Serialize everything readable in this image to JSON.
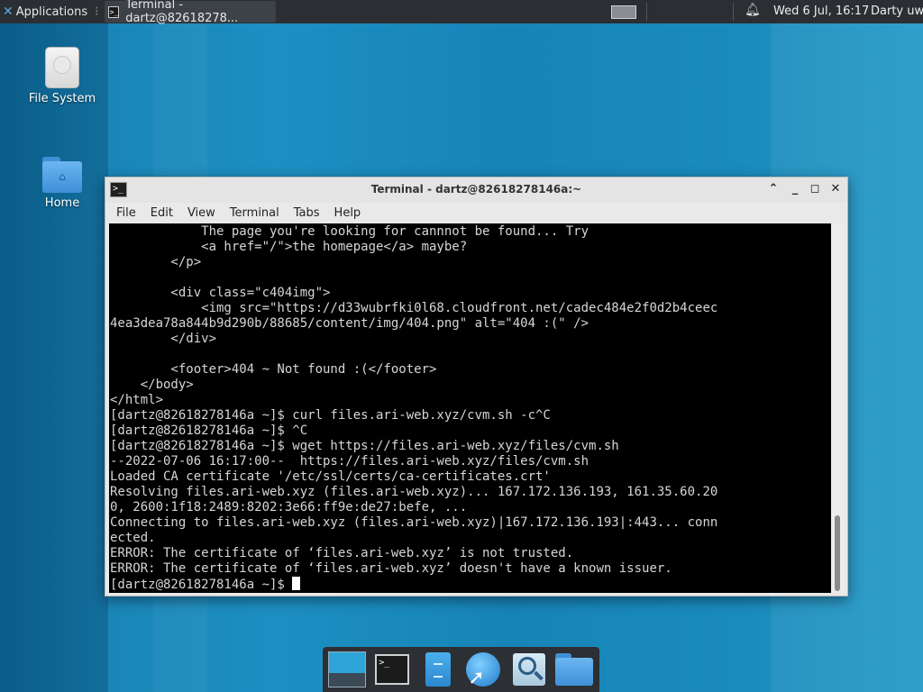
{
  "top_panel": {
    "applications_label": "Applications",
    "task_title": "Terminal - dartz@82618278...",
    "clock": "Wed  6 Jul, 16:17",
    "user": "Darty uwu"
  },
  "desktop": {
    "icons": [
      {
        "label": "File System",
        "icon": "drive-icon"
      },
      {
        "label": "Home",
        "icon": "home-folder-icon"
      }
    ]
  },
  "window": {
    "title": "Terminal - dartz@82618278146a:~",
    "menu": [
      "File",
      "Edit",
      "View",
      "Terminal",
      "Tabs",
      "Help"
    ],
    "terminal_lines": [
      "            The page you're looking for cannnot be found... Try",
      "            <a href=\"/\">the homepage</a> maybe?",
      "        </p>",
      "",
      "        <div class=\"c404img\">",
      "            <img src=\"https://d33wubrfki0l68.cloudfront.net/cadec484e2f0d2b4ceec",
      "4ea3dea78a844b9d290b/88685/content/img/404.png\" alt=\"404 :(\" />",
      "        </div>",
      "",
      "        <footer>404 ~ Not found :(</footer>",
      "    </body>",
      "</html>",
      "[dartz@82618278146a ~]$ curl files.ari-web.xyz/cvm.sh -c^C",
      "[dartz@82618278146a ~]$ ^C",
      "[dartz@82618278146a ~]$ wget https://files.ari-web.xyz/files/cvm.sh",
      "--2022-07-06 16:17:00--  https://files.ari-web.xyz/files/cvm.sh",
      "Loaded CA certificate '/etc/ssl/certs/ca-certificates.crt'",
      "Resolving files.ari-web.xyz (files.ari-web.xyz)... 167.172.136.193, 161.35.60.20",
      "0, 2600:1f18:2489:8202:3e66:ff9e:de27:befe, ...",
      "Connecting to files.ari-web.xyz (files.ari-web.xyz)|167.172.136.193|:443... conn",
      "ected.",
      "ERROR: The certificate of ‘files.ari-web.xyz’ is not trusted.",
      "ERROR: The certificate of ‘files.ari-web.xyz’ doesn't have a known issuer."
    ],
    "prompt": "[dartz@82618278146a ~]$ "
  },
  "dock": {
    "items": [
      "show-desktop-icon",
      "terminal-icon",
      "file-cabinet-icon",
      "web-browser-icon",
      "app-finder-icon",
      "file-manager-icon"
    ]
  }
}
